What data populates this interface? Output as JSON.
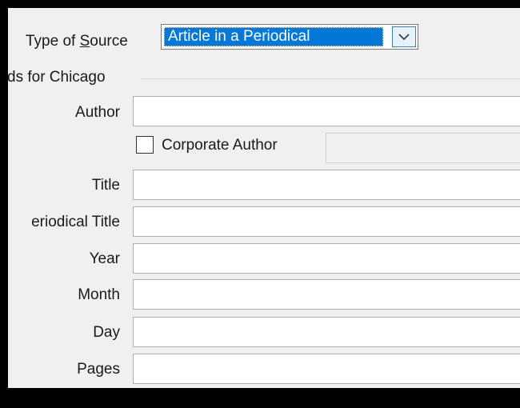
{
  "source": {
    "label_prefix": "Type of ",
    "label_accel": "S",
    "label_suffix": "ource",
    "selected": "Article in a Periodical"
  },
  "group": {
    "title": "ds for Chicago"
  },
  "fields": {
    "author": "Author",
    "corporate_author": "Corporate Author",
    "title": "Title",
    "periodical_title": "eriodical Title",
    "year": "Year",
    "month": "Month",
    "day": "Day",
    "pages": "Pages"
  },
  "icons": {
    "dropdown": "chevron-down-icon"
  },
  "colors": {
    "selection": "#0078d7",
    "dialog_bg": "#f0f0f0",
    "frame": "#000000"
  }
}
